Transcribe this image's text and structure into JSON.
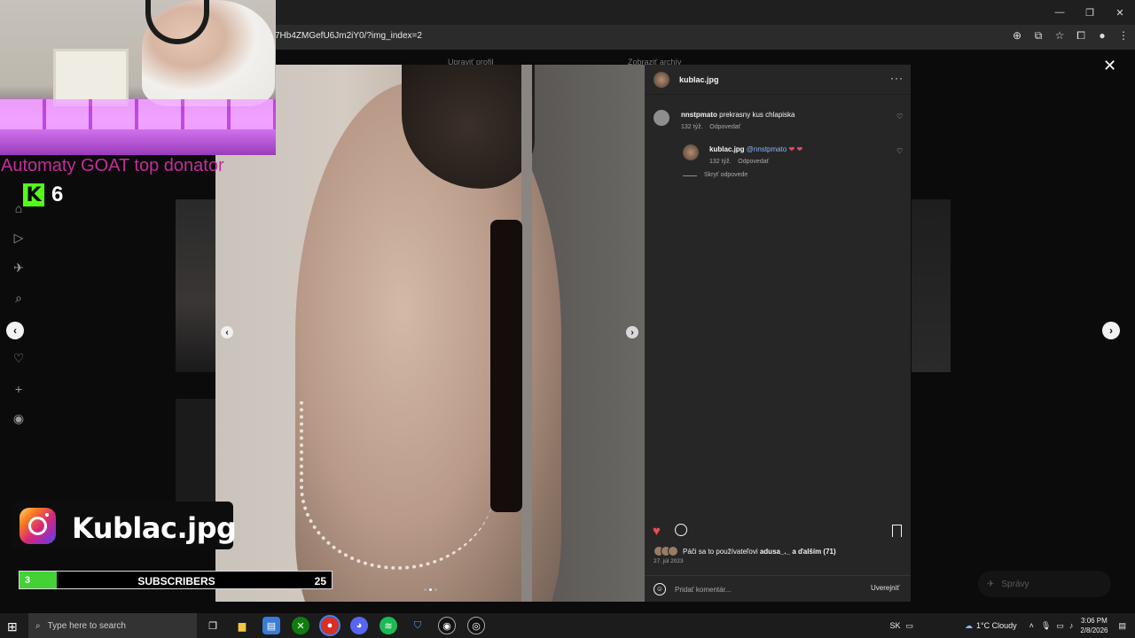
{
  "browser": {
    "url_fragment": "7Hb4ZMGefU6Jm2iY0/?img_index=2",
    "window_controls": [
      "—",
      "❐",
      "✕"
    ],
    "toolbar_icons": [
      "zoom-icon",
      "install-icon",
      "star-icon",
      "extensions-icon",
      "profile-icon",
      "menu-icon"
    ]
  },
  "background_page": {
    "profile_tabs": [
      "Upraviť profil",
      "Zobraziť archív"
    ],
    "left_rail_icons": [
      "home-icon",
      "reels-icon",
      "explore-icon",
      "search-icon",
      "messenger-icon",
      "heart-icon",
      "create-icon",
      "profile-icon"
    ],
    "messages_label": "Správy"
  },
  "post": {
    "author": "kublac.jpg",
    "more_glyph": "···",
    "image_index": 2,
    "image_count": 3,
    "comments": [
      {
        "user": "nnstpmato",
        "text": "prekrasny kus chlapiska",
        "time": "132 týž.",
        "reply_label": "Odpovedať",
        "replies": [
          {
            "user": "kublac.jpg",
            "mention": "@nnstpmato",
            "hearts": "❤ ❤",
            "time": "132 týž.",
            "reply_label": "Odpovedať"
          }
        ],
        "hide_replies_label": "Skryť odpovede"
      }
    ],
    "likes_prefix": "Páči sa to používateľovi",
    "likes_user": "adusa_._",
    "likes_suffix": "a ďalším (71)",
    "date": "27. júl 2023",
    "comment_placeholder": "Pridať komentár...",
    "publish_label": "Uverejniť"
  },
  "overlay": {
    "donator_text": "Automaty GOAT top donator",
    "kick_count": "6",
    "instagram_handle": "Kublac.jpg",
    "subs_start": "3",
    "subs_label": "SUBSCRIBERS",
    "subs_goal": "25",
    "subs_progress": 0.12
  },
  "taskbar": {
    "search_placeholder": "Type here to search",
    "language": "SK",
    "weather": "1°C  Cloudy",
    "time": "3:06 PM",
    "date": "2/8/2026"
  },
  "colors": {
    "instagram_like": "#ed4956",
    "kick_green": "#53fc18",
    "donator_text": "#c52c9b",
    "subs_fill": "#43d135"
  }
}
